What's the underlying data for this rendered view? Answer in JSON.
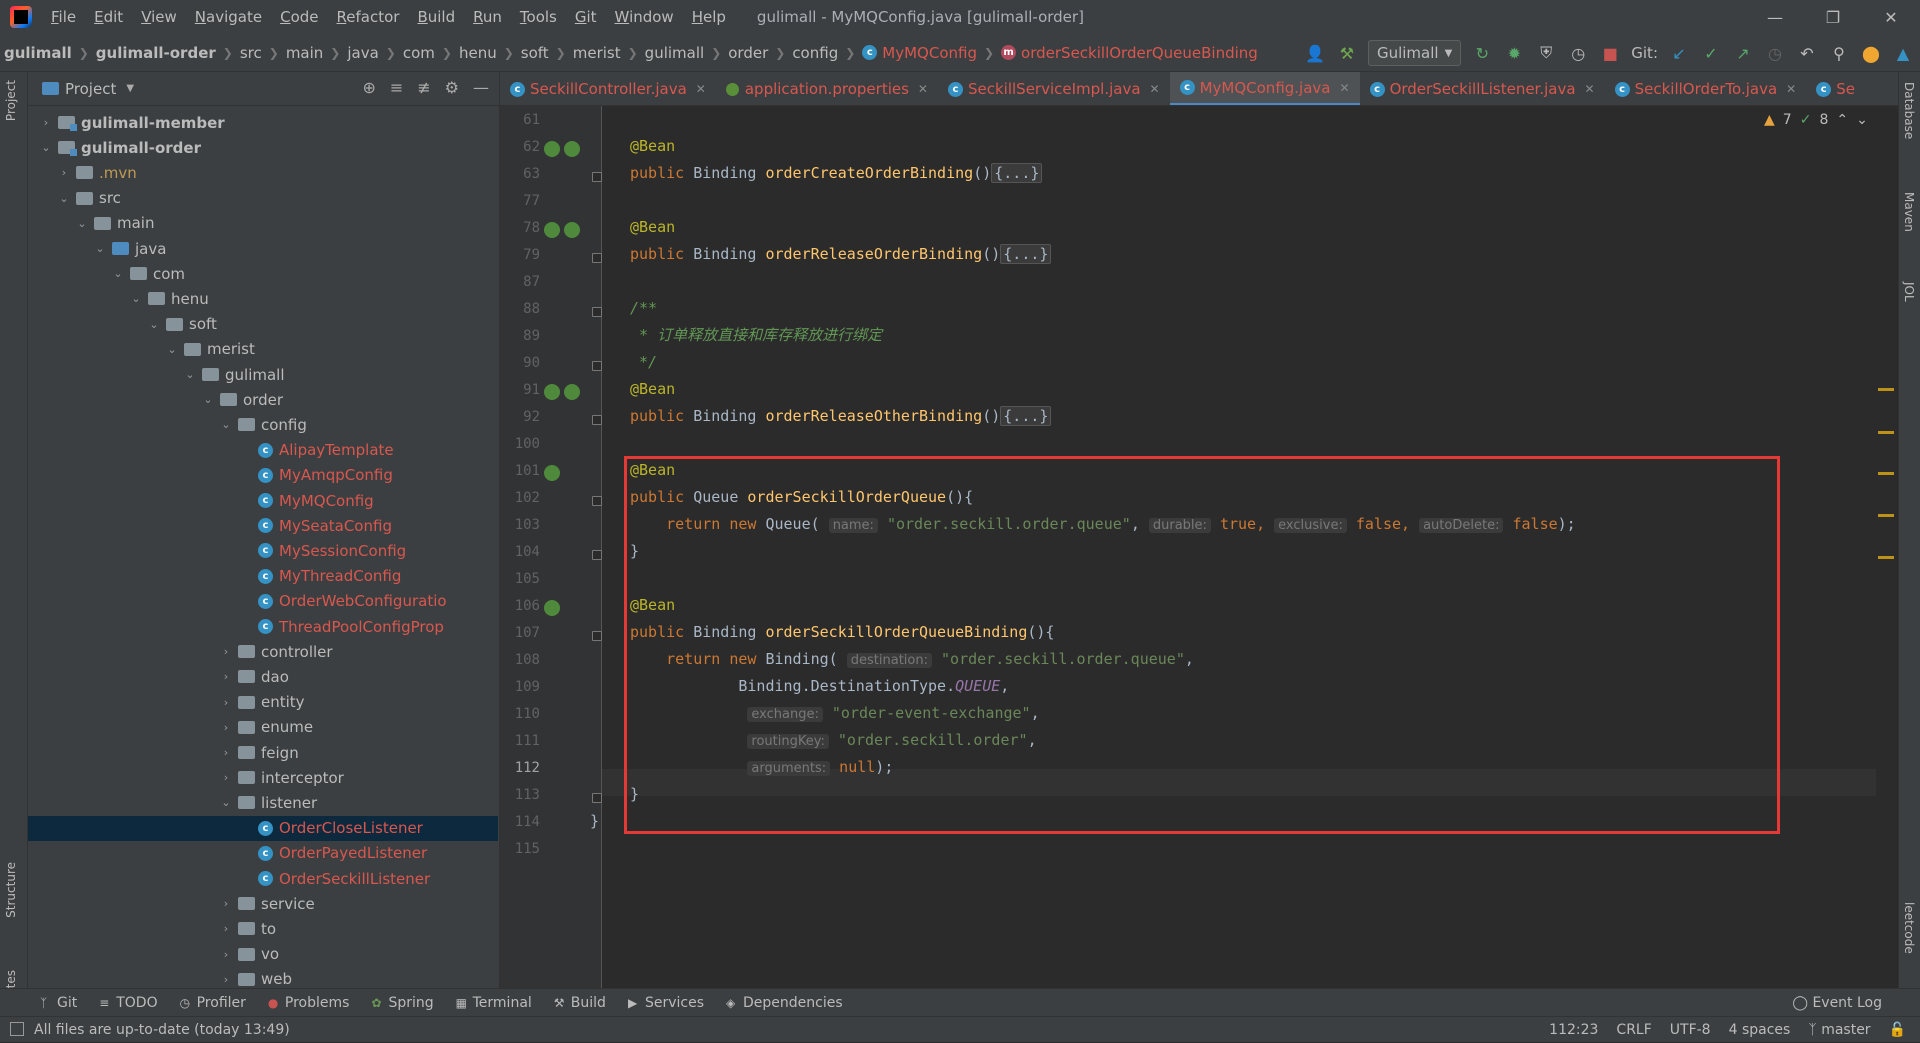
{
  "menu": {
    "items": [
      "File",
      "Edit",
      "View",
      "Navigate",
      "Code",
      "Refactor",
      "Build",
      "Run",
      "Tools",
      "Git",
      "Window",
      "Help"
    ],
    "window_title": "gulimall - MyMQConfig.java [gulimall-order]"
  },
  "breadcrumbs": [
    "gulimall",
    "gulimall-order",
    "src",
    "main",
    "java",
    "com",
    "henu",
    "soft",
    "merist",
    "gulimall",
    "order",
    "config",
    "MyMQConfig",
    "orderSeckillOrderQueueBinding"
  ],
  "toolbar": {
    "run_config": "Gulimall",
    "git_label": "Git:"
  },
  "project": {
    "title": "Project",
    "tree": [
      {
        "label": "gulimall-member",
        "style": "bold"
      },
      {
        "label": "gulimall-order",
        "style": "bold"
      },
      {
        "label": ".mvn",
        "style": "orange"
      },
      {
        "label": "src",
        "style": "normal"
      },
      {
        "label": "main",
        "style": "normal"
      },
      {
        "label": "java",
        "style": "normal"
      },
      {
        "label": "com",
        "style": "normal"
      },
      {
        "label": "henu",
        "style": "normal"
      },
      {
        "label": "soft",
        "style": "normal"
      },
      {
        "label": "merist",
        "style": "normal"
      },
      {
        "label": "gulimall",
        "style": "normal"
      },
      {
        "label": "order",
        "style": "normal"
      },
      {
        "label": "config",
        "style": "normal"
      },
      {
        "label": "AlipayTemplate",
        "style": "red"
      },
      {
        "label": "MyAmqpConfig",
        "style": "red"
      },
      {
        "label": "MyMQConfig",
        "style": "red"
      },
      {
        "label": "MySeataConfig",
        "style": "red"
      },
      {
        "label": "MySessionConfig",
        "style": "red"
      },
      {
        "label": "MyThreadConfig",
        "style": "red"
      },
      {
        "label": "OrderWebConfiguratio",
        "style": "red"
      },
      {
        "label": "ThreadPoolConfigProp",
        "style": "red"
      },
      {
        "label": "controller",
        "style": "normal"
      },
      {
        "label": "dao",
        "style": "normal"
      },
      {
        "label": "entity",
        "style": "normal"
      },
      {
        "label": "enume",
        "style": "normal"
      },
      {
        "label": "feign",
        "style": "normal"
      },
      {
        "label": "interceptor",
        "style": "normal"
      },
      {
        "label": "listener",
        "style": "normal"
      },
      {
        "label": "OrderCloseListener",
        "style": "red"
      },
      {
        "label": "OrderPayedListener",
        "style": "red"
      },
      {
        "label": "OrderSeckillListener",
        "style": "red"
      },
      {
        "label": "service",
        "style": "normal"
      },
      {
        "label": "to",
        "style": "normal"
      },
      {
        "label": "vo",
        "style": "normal"
      },
      {
        "label": "web",
        "style": "normal"
      }
    ]
  },
  "tabs": [
    "SeckillController.java",
    "application.properties",
    "SeckillServiceImpl.java",
    "MyMQConfig.java",
    "OrderSeckillListener.java",
    "SeckillOrderTo.java",
    "Se"
  ],
  "inspections": {
    "warnings": "7",
    "ok": "8"
  },
  "editor": {
    "line_numbers": [
      "61",
      "62",
      "63",
      "77",
      "78",
      "79",
      "87",
      "88",
      "89",
      "90",
      "91",
      "92",
      "100",
      "101",
      "102",
      "103",
      "104",
      "105",
      "106",
      "107",
      "108",
      "109",
      "110",
      "111",
      "112",
      "113",
      "114",
      "115"
    ],
    "current_line": "112",
    "lines": {
      "l62": "@Bean",
      "l63_kw": "public",
      "l63_type": "Binding",
      "l63_fn": "orderCreateOrderBinding",
      "l63_paren": "()",
      "l63_fold": "{...}",
      "l78": "@Bean",
      "l79_kw": "public",
      "l79_type": "Binding",
      "l79_fn": "orderReleaseOrderBinding",
      "l79_paren": "()",
      "l79_fold": "{...}",
      "l88": "/**",
      "l89": " * 订单释放直接和库存释放进行绑定",
      "l90": " */",
      "l91": "@Bean",
      "l92_kw": "public",
      "l92_type": "Binding",
      "l92_fn": "orderReleaseOtherBinding",
      "l92_paren": "()",
      "l92_fold": "{...}",
      "l101": "@Bean",
      "l102_kw": "public",
      "l102_type": "Queue",
      "l102_fn": "orderSeckillOrderQueue",
      "l102_rest": "(){",
      "l103_kw": "return new",
      "l103_type": "Queue(",
      "l103_h1": "name:",
      "l103_s1": "\"order.seckill.order.queue\"",
      "l103_h2": "durable:",
      "l103_v2": "true,",
      "l103_h3": "exclusive:",
      "l103_v3": "false,",
      "l103_h4": "autoDelete:",
      "l103_v4": "false",
      "l103_end": ");",
      "l104": "}",
      "l106": "@Bean",
      "l107_kw": "public",
      "l107_type": "Binding",
      "l107_fn": "orderSeckillOrderQueueBinding",
      "l107_rest": "(){",
      "l108_kw": "return new",
      "l108_type": "Binding(",
      "l108_h1": "destination:",
      "l108_s1": "\"order.seckill.order.queue\"",
      "l109_a": "Binding.DestinationType.",
      "l109_c": "QUEUE",
      "l110_h": "exchange:",
      "l110_s": "\"order-event-exchange\"",
      "l111_h": "routingKey:",
      "l111_s": "\"order.seckill.order\"",
      "l112_h": "arguments:",
      "l112_v": "null",
      "l112_end": ");",
      "l113": "}",
      "l114": "}"
    }
  },
  "bottom_tools": [
    "Git",
    "TODO",
    "Profiler",
    "Problems",
    "Spring",
    "Terminal",
    "Build",
    "Services",
    "Dependencies"
  ],
  "event_log": "Event Log",
  "status": {
    "message": "All files are up-to-date (today 13:49)",
    "position": "112:23",
    "line_sep": "CRLF",
    "encoding": "UTF-8",
    "indent": "4 spaces",
    "branch": "master"
  },
  "side_tabs": {
    "left": [
      "Project",
      "Structure",
      "Favorites"
    ],
    "right": [
      "Database",
      "Maven",
      "JOL",
      "leetcode"
    ]
  }
}
